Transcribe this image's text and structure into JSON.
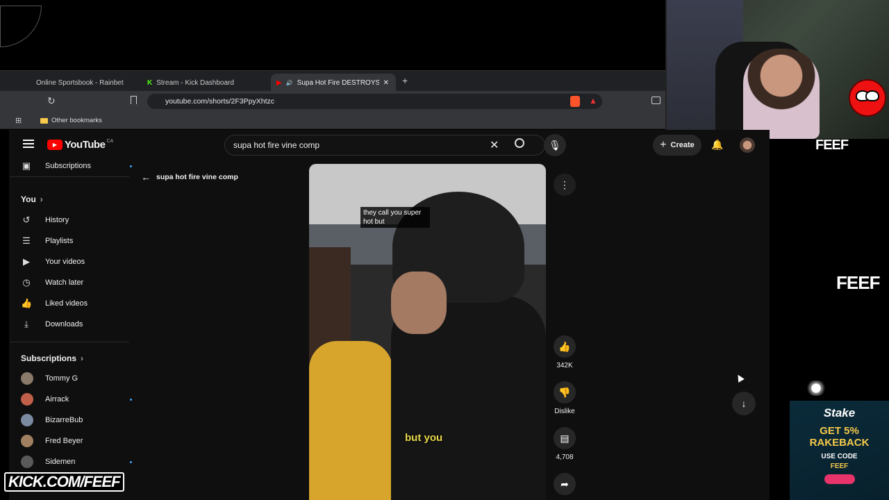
{
  "browser": {
    "tabs": [
      {
        "label": "Online Sportsbook - Rainbet"
      },
      {
        "label": "Stream - Kick Dashboard"
      },
      {
        "label": "Supa Hot Fire DESTROYS Bab"
      }
    ],
    "url": "youtube.com/shorts/2F3PpyXhtzc",
    "bookmarks_folder": "Other bookmarks"
  },
  "youtube": {
    "logo": "YouTube",
    "region": "CA",
    "search_value": "supa hot fire vine comp",
    "create_label": "Create",
    "back_title": "supa hot fire vine comp",
    "sidebar": {
      "subscriptions_top": "Subscriptions",
      "you_label": "You",
      "you_items": [
        {
          "label": "History",
          "icon": "history-icon"
        },
        {
          "label": "Playlists",
          "icon": "playlists-icon"
        },
        {
          "label": "Your videos",
          "icon": "your-videos-icon"
        },
        {
          "label": "Watch later",
          "icon": "watch-later-icon"
        },
        {
          "label": "Liked videos",
          "icon": "liked-videos-icon"
        },
        {
          "label": "Downloads",
          "icon": "downloads-icon"
        }
      ],
      "subscriptions_heading": "Subscriptions",
      "channels": [
        {
          "name": "Tommy G",
          "new": false,
          "color": "#8a7a6a"
        },
        {
          "name": "Airrack",
          "new": true,
          "color": "#c0604a"
        },
        {
          "name": "BizarreBub",
          "new": false,
          "color": "#7a8aa0"
        },
        {
          "name": "Fred Beyer",
          "new": false,
          "color": "#a08060"
        },
        {
          "name": "Sidemen",
          "new": true,
          "color": "#5a5a5a"
        }
      ]
    },
    "short": {
      "caption": "they call you super hot but",
      "subtitle": "but you",
      "likes": "342K",
      "dislike_label": "Dislike",
      "comments": "4,708"
    }
  },
  "overlay": {
    "kick_banner": "KICK.COM/FEEF",
    "feef_tag": "FEEF",
    "stake": {
      "brand": "Stake",
      "headline_1": "GET 5%",
      "headline_2": "RAKEBACK",
      "use_code": "USE CODE",
      "code": "FEEF"
    }
  },
  "colors": {
    "youtube_red": "#ff0000",
    "kick_green": "#53fc18",
    "yt_bg": "#0f0f0f",
    "unread_dot": "#3ea6ff"
  }
}
